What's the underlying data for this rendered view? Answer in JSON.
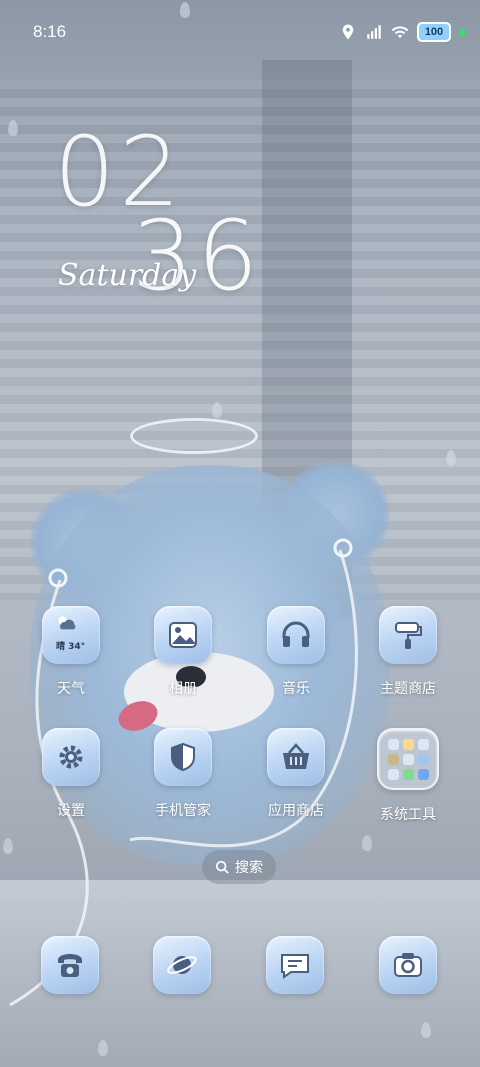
{
  "status_bar": {
    "time": "8:16",
    "battery": "100",
    "icons": [
      "location-icon",
      "signal-icon",
      "wifi-icon",
      "battery-icon"
    ]
  },
  "clock": {
    "hours": "02",
    "minutes": "36",
    "day": "Saturday"
  },
  "apps": [
    {
      "label": "天气",
      "icon": "weather-icon",
      "badge_text": "晴 34°"
    },
    {
      "label": "相册",
      "icon": "gallery-icon"
    },
    {
      "label": "音乐",
      "icon": "headphones-icon"
    },
    {
      "label": "主题商店",
      "icon": "paint-roller-icon"
    },
    {
      "label": "设置",
      "icon": "gear-icon"
    },
    {
      "label": "手机管家",
      "icon": "shield-icon"
    },
    {
      "label": "应用商店",
      "icon": "basket-icon"
    },
    {
      "label": "系统工具",
      "icon": "folder-icon"
    }
  ],
  "search": {
    "label": "搜索",
    "icon": "search-icon"
  },
  "dock": [
    {
      "icon": "phone-icon"
    },
    {
      "icon": "browser-planet-icon"
    },
    {
      "icon": "message-icon"
    },
    {
      "icon": "camera-icon"
    }
  ],
  "colors": {
    "icon_gradient_top": "#e9f3ff",
    "icon_gradient_bottom": "#9fbfe6",
    "icon_glyph": "#4a5f80",
    "status_dot": "#2ee26a"
  }
}
